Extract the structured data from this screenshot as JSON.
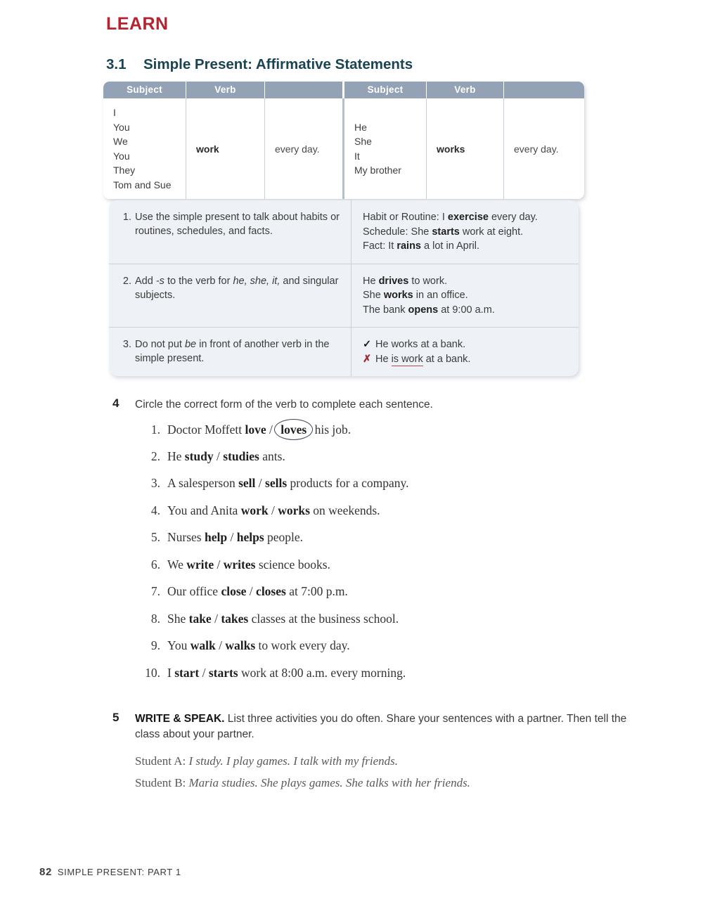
{
  "header": {
    "learn_label": "LEARN",
    "section_number": "3.1",
    "section_title": "Simple Present: Affirmative Statements"
  },
  "colors": {
    "learn_red": "#b32430",
    "section_teal": "#1b4452",
    "table_header_bg": "#93a2b5",
    "notes_bg": "#eef1f5",
    "error_red": "#9e2a35"
  },
  "grammar_chart": {
    "headers": [
      "Subject",
      "Verb",
      "",
      "Subject",
      "Verb",
      ""
    ],
    "left": {
      "subjects": [
        "I",
        "You",
        "We",
        "You",
        "They",
        "Tom and Sue"
      ],
      "verb": "work",
      "time": "every day."
    },
    "right": {
      "subjects": [
        "He",
        "She",
        "It",
        "My brother"
      ],
      "verb": "works",
      "time": "every day."
    }
  },
  "notes": [
    {
      "number": "1.",
      "rule_pre": "Use the simple present to talk about habits or routines, schedules, and facts.",
      "examples": [
        {
          "pre": "Habit or Routine: I ",
          "bold": "exercise",
          "post": " every day."
        },
        {
          "pre": "Schedule: She ",
          "bold": "starts",
          "post": " work at eight."
        },
        {
          "pre": "Fact: It ",
          "bold": "rains",
          "post": " a lot in April."
        }
      ]
    },
    {
      "number": "2.",
      "rule_pre": "Add ",
      "rule_italic1": "-s",
      "rule_mid": " to the verb for ",
      "rule_italic2": "he, she, it,",
      "rule_post": " and singular subjects.",
      "examples": [
        {
          "pre": "He ",
          "bold": "drives",
          "post": " to work."
        },
        {
          "pre": "She ",
          "bold": "works",
          "post": " in an office."
        },
        {
          "pre": "The bank ",
          "bold": "opens",
          "post": " at 9:00 a.m."
        }
      ]
    },
    {
      "number": "3.",
      "rule_pre": "Do not put ",
      "rule_italic1": "be",
      "rule_post": " in front of another verb in the simple present.",
      "examples_marked": [
        {
          "mark": "✓",
          "mark_type": "correct",
          "pre": "He works at a bank.",
          "wrong": "",
          "post": ""
        },
        {
          "mark": "✗",
          "mark_type": "incorrect",
          "pre": "He ",
          "wrong": "is work",
          "post": " at a bank."
        }
      ]
    }
  ],
  "exercise4": {
    "number": "4",
    "direction": "Circle the correct form of the verb to complete each sentence.",
    "items": [
      {
        "num": "1.",
        "pre": "Doctor Moffett ",
        "opt1": "love",
        "sep": " / ",
        "opt2": "loves",
        "post": " his job.",
        "circled": "opt2"
      },
      {
        "num": "2.",
        "pre": "He ",
        "opt1": "study",
        "sep": " / ",
        "opt2": "studies",
        "post": " ants.",
        "circled": ""
      },
      {
        "num": "3.",
        "pre": "A salesperson ",
        "opt1": "sell",
        "sep": " / ",
        "opt2": "sells",
        "post": " products for a company.",
        "circled": ""
      },
      {
        "num": "4.",
        "pre": "You and Anita ",
        "opt1": "work",
        "sep": " / ",
        "opt2": "works",
        "post": " on weekends.",
        "circled": ""
      },
      {
        "num": "5.",
        "pre": "Nurses ",
        "opt1": "help",
        "sep": " / ",
        "opt2": "helps",
        "post": " people.",
        "circled": ""
      },
      {
        "num": "6.",
        "pre": "We ",
        "opt1": "write",
        "sep": " / ",
        "opt2": "writes",
        "post": " science books.",
        "circled": ""
      },
      {
        "num": "7.",
        "pre": "Our office ",
        "opt1": "close",
        "sep": " / ",
        "opt2": "closes",
        "post": " at 7:00 p.m.",
        "circled": ""
      },
      {
        "num": "8.",
        "pre": "She ",
        "opt1": "take",
        "sep": " / ",
        "opt2": "takes",
        "post": " classes at the business school.",
        "circled": ""
      },
      {
        "num": "9.",
        "pre": "You ",
        "opt1": "walk",
        "sep": " / ",
        "opt2": "walks",
        "post": " to work every day.",
        "circled": ""
      },
      {
        "num": "10.",
        "pre": "I ",
        "opt1": "start",
        "sep": " / ",
        "opt2": "starts",
        "post": " work at 8:00 a.m. every morning.",
        "circled": ""
      }
    ]
  },
  "exercise5": {
    "number": "5",
    "label": "WRITE & SPEAK.",
    "direction": " List three activities you do often. Share your sentences with a partner. Then tell the class about your partner.",
    "samples": [
      {
        "speaker": "Student A: ",
        "text": "I study. I play games. I talk with my friends."
      },
      {
        "speaker": "Student B: ",
        "text": "Maria studies. She plays games. She talks with her friends."
      }
    ]
  },
  "footer": {
    "page_number": "82",
    "running_head": "SIMPLE PRESENT: PART 1"
  }
}
